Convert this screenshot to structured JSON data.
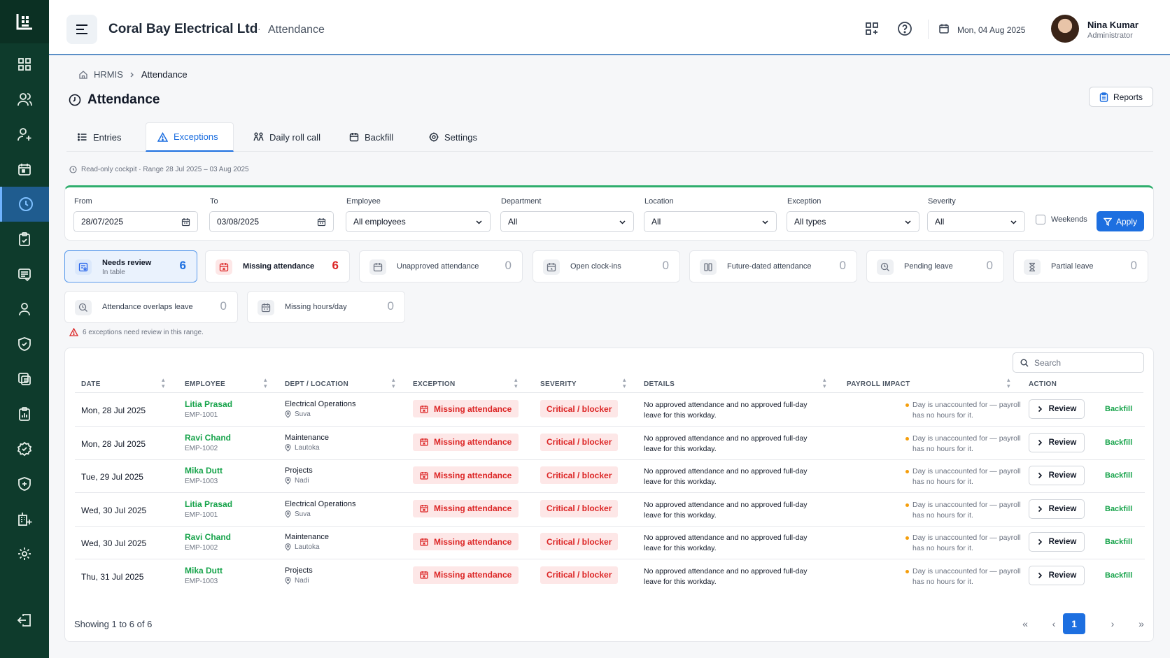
{
  "app": {
    "company": "Coral Bay Electrical Ltd",
    "separator": "·",
    "page": "Attendance",
    "date": "Mon, 04 Aug 2025"
  },
  "user": {
    "name": "Nina Kumar",
    "role": "Administrator"
  },
  "breadcrumb": {
    "root": "HRMIS",
    "current": "Attendance"
  },
  "title": "Attendance",
  "reports_label": "Reports",
  "tabs": [
    {
      "label": "Entries",
      "icon": "list-icon"
    },
    {
      "label": "Exceptions",
      "icon": "warning-icon",
      "active": true
    },
    {
      "label": "Daily roll call",
      "icon": "roll-call-icon"
    },
    {
      "label": "Backfill",
      "icon": "calendar-icon"
    },
    {
      "label": "Settings",
      "icon": "gear-icon"
    }
  ],
  "note": "Read-only cockpit · Range 28 Jul 2025 – 03 Aug 2025",
  "filters": {
    "from_label": "From",
    "from_value": "28/07/2025",
    "to_label": "To",
    "to_value": "03/08/2025",
    "employee_label": "Employee",
    "employee_value": "All employees",
    "department_label": "Department",
    "department_value": "All",
    "location_label": "Location",
    "location_value": "All",
    "exception_label": "Exception",
    "exception_value": "All types",
    "severity_label": "Severity",
    "severity_value": "All",
    "weekends_label": "Weekends",
    "apply_label": "Apply"
  },
  "cards": [
    {
      "label": "Needs review",
      "sub": "In table",
      "count": "6"
    },
    {
      "label": "Missing attendance",
      "count": "6"
    },
    {
      "label": "Unapproved attendance",
      "count": "0"
    },
    {
      "label": "Open clock-ins",
      "count": "0"
    },
    {
      "label": "Future-dated attendance",
      "count": "0"
    },
    {
      "label": "Pending leave",
      "count": "0"
    },
    {
      "label": "Partial leave",
      "count": "0"
    },
    {
      "label": "Attendance overlaps leave",
      "count": "0"
    },
    {
      "label": "Missing hours/day",
      "count": "0"
    }
  ],
  "warning": "6 exceptions need review in this range.",
  "table": {
    "search_placeholder": "Search",
    "headers": [
      "DATE",
      "EMPLOYEE",
      "DEPT / LOCATION",
      "EXCEPTION",
      "SEVERITY",
      "DETAILS",
      "PAYROLL IMPACT",
      "ACTION"
    ],
    "rows": [
      {
        "date": "Mon, 28 Jul 2025",
        "name": "Litia Prasad",
        "emp": "EMP-1001",
        "dept": "Electrical Operations",
        "loc": "Suva",
        "exception": "Missing attendance",
        "severity": "Critical / blocker",
        "details": "No approved attendance and no approved full-day leave for this workday.",
        "payroll": "Day is unaccounted for — payroll has no hours for it.",
        "review": "Review",
        "backfill": "Backfill"
      },
      {
        "date": "Mon, 28 Jul 2025",
        "name": "Ravi Chand",
        "emp": "EMP-1002",
        "dept": "Maintenance",
        "loc": "Lautoka",
        "exception": "Missing attendance",
        "severity": "Critical / blocker",
        "details": "No approved attendance and no approved full-day leave for this workday.",
        "payroll": "Day is unaccounted for — payroll has no hours for it.",
        "review": "Review",
        "backfill": "Backfill"
      },
      {
        "date": "Tue, 29 Jul 2025",
        "name": "Mika Dutt",
        "emp": "EMP-1003",
        "dept": "Projects",
        "loc": "Nadi",
        "exception": "Missing attendance",
        "severity": "Critical / blocker",
        "details": "No approved attendance and no approved full-day leave for this workday.",
        "payroll": "Day is unaccounted for — payroll has no hours for it.",
        "review": "Review",
        "backfill": "Backfill"
      },
      {
        "date": "Wed, 30 Jul 2025",
        "name": "Litia Prasad",
        "emp": "EMP-1001",
        "dept": "Electrical Operations",
        "loc": "Suva",
        "exception": "Missing attendance",
        "severity": "Critical / blocker",
        "details": "No approved attendance and no approved full-day leave for this workday.",
        "payroll": "Day is unaccounted for — payroll has no hours for it.",
        "review": "Review",
        "backfill": "Backfill"
      },
      {
        "date": "Wed, 30 Jul 2025",
        "name": "Ravi Chand",
        "emp": "EMP-1002",
        "dept": "Maintenance",
        "loc": "Lautoka",
        "exception": "Missing attendance",
        "severity": "Critical / blocker",
        "details": "No approved attendance and no approved full-day leave for this workday.",
        "payroll": "Day is unaccounted for — payroll has no hours for it.",
        "review": "Review",
        "backfill": "Backfill"
      },
      {
        "date": "Thu, 31 Jul 2025",
        "name": "Mika Dutt",
        "emp": "EMP-1003",
        "dept": "Projects",
        "loc": "Nadi",
        "exception": "Missing attendance",
        "severity": "Critical / blocker",
        "details": "No approved attendance and no approved full-day leave for this workday.",
        "payroll": "Day is unaccounted for — payroll has no hours for it.",
        "review": "Review",
        "backfill": "Backfill"
      }
    ]
  },
  "pagination": {
    "showing": "Showing 1 to 6 of 6",
    "first": "«",
    "prev": "‹",
    "current": "1",
    "next": "›",
    "last": "»"
  },
  "colors": {
    "sidebar": "#0e3b2c",
    "accent": "#1d6fe0",
    "success": "#16a34a",
    "danger": "#dc2626",
    "filter_top": "#2fae6d"
  }
}
